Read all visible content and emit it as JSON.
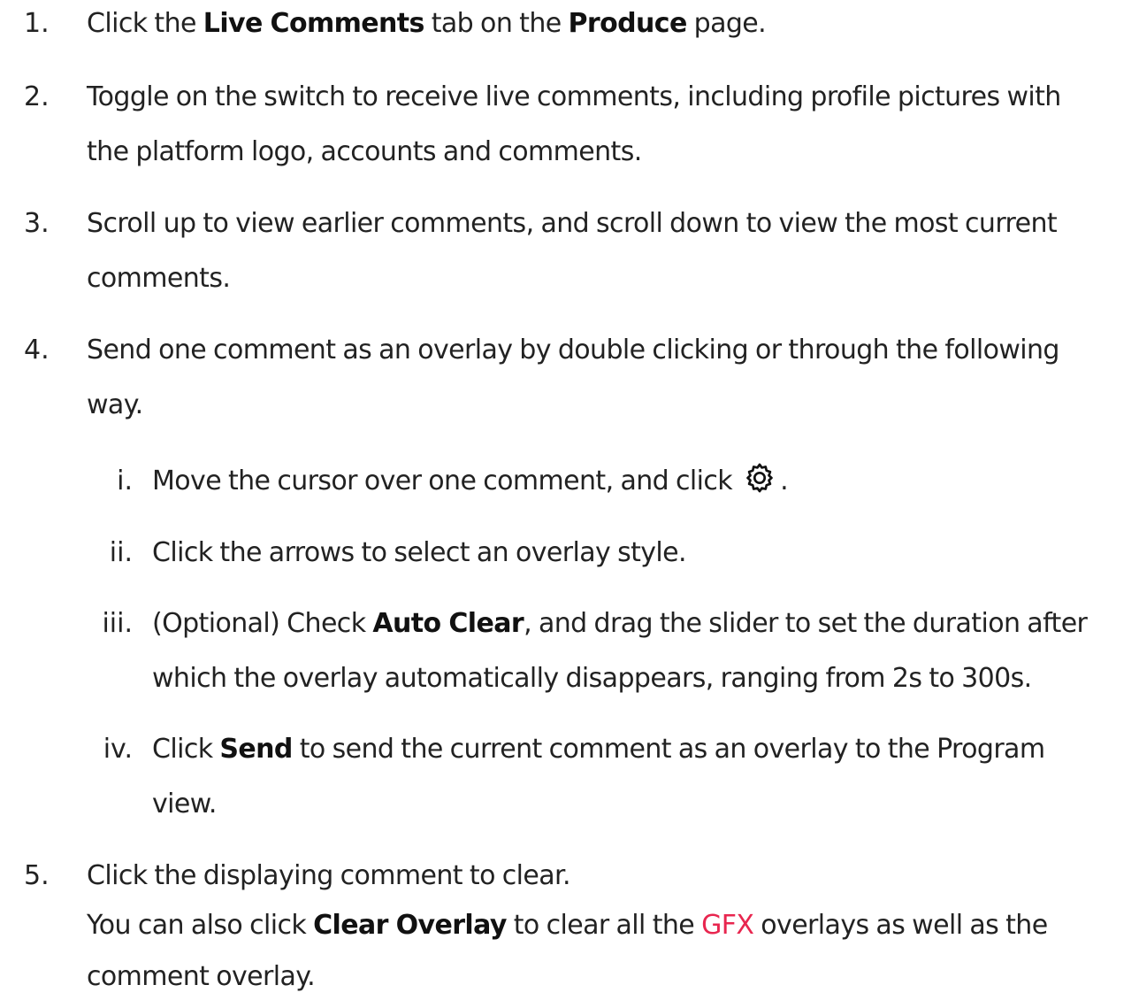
{
  "steps": [
    {
      "number": "1.",
      "parts": {
        "a": "Click the ",
        "b": "Live Comments",
        "c": " tab on the ",
        "d": "Produce",
        "e": " page."
      }
    },
    {
      "number": "2.",
      "line1": "Toggle on the switch to receive live comments, including profile pictures with",
      "line2": "the platform logo, accounts and comments."
    },
    {
      "number": "3.",
      "line1": "Scroll up to view earlier comments, and scroll down to view the most current",
      "line2": "comments."
    },
    {
      "number": "4.",
      "line1": "Send one comment as an overlay by double clicking or through the following",
      "line2": "way."
    },
    {
      "number": "5.",
      "line1": "Click the displaying comment to clear.",
      "line2_parts": {
        "a": "You can also click ",
        "b": "Clear Overlay",
        "c": " to clear all the ",
        "d": "GFX",
        "e": " overlays as well as the"
      },
      "line3": "comment overlay."
    }
  ],
  "substeps": [
    {
      "number": "i.",
      "parts": {
        "a": "Move the cursor over one comment, and click",
        "icon": "gear-icon",
        "b": "."
      }
    },
    {
      "number": "ii.",
      "line1": "Click the arrows to select an overlay style."
    },
    {
      "number": "iii.",
      "parts": {
        "a": "(Optional) Check ",
        "b": "Auto Clear",
        "c": ", and drag the slider to set the duration after"
      },
      "line2": "which the overlay automatically disappears, ranging from 2s to 300s."
    },
    {
      "number": "iv.",
      "parts": {
        "a": "Click ",
        "b": "Send",
        "c": " to send the current comment as an overlay to the Program"
      },
      "line2": "view."
    }
  ],
  "colors": {
    "text": "#222222",
    "link_highlight": "#e8264f"
  }
}
